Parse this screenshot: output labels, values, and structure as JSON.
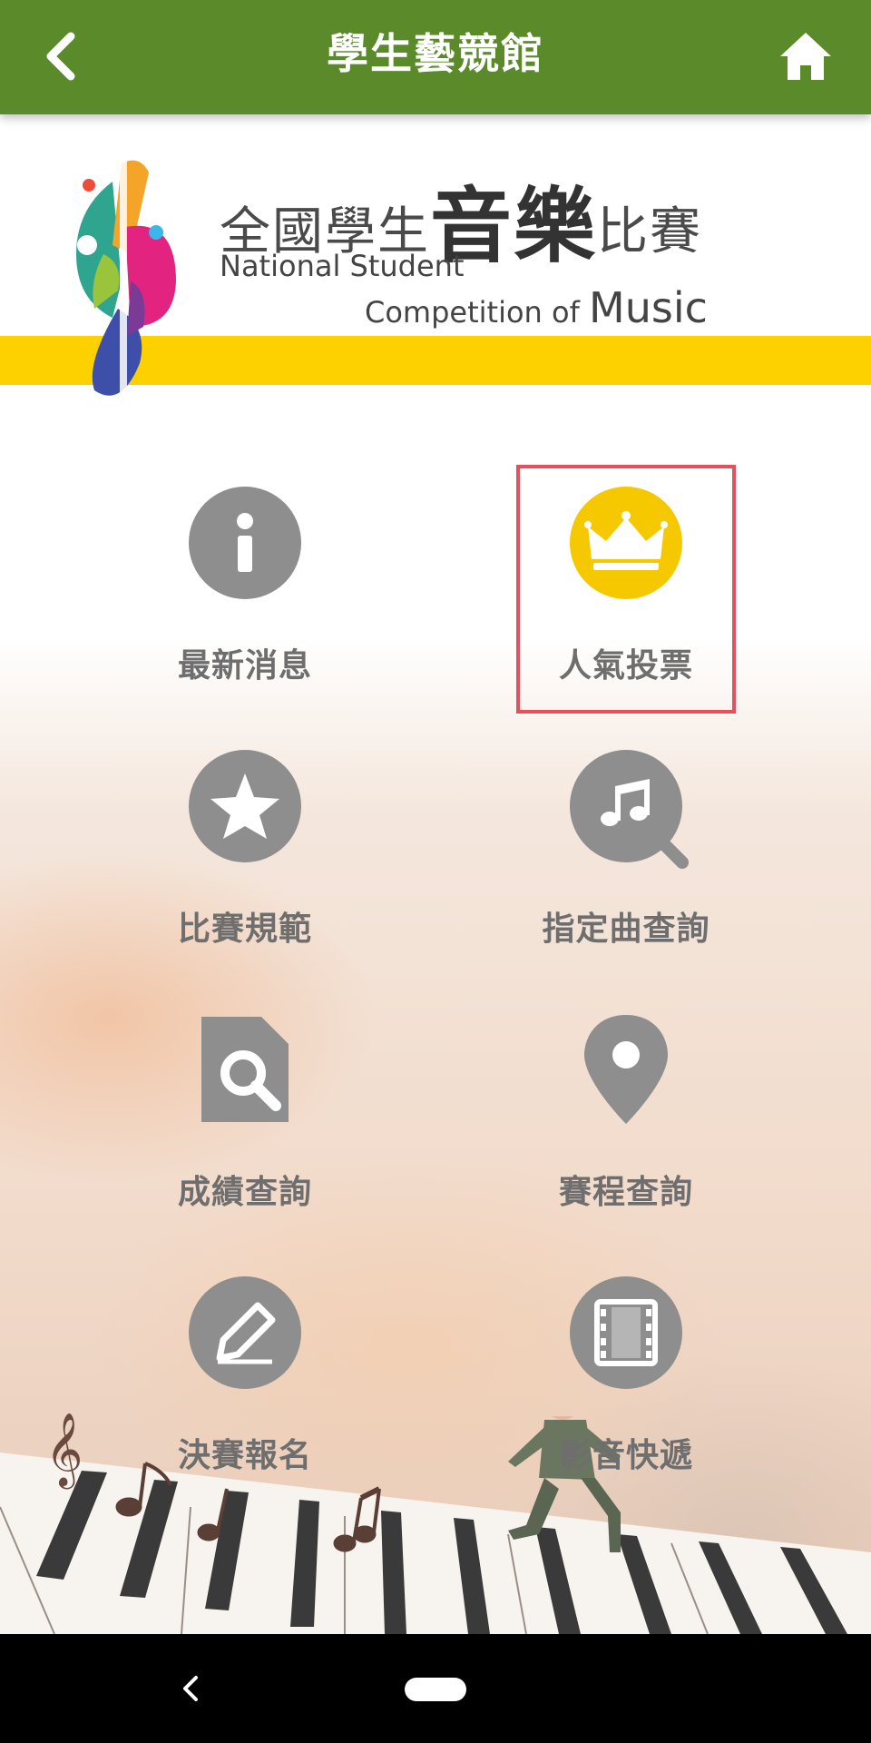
{
  "header": {
    "title": "學生藝競館",
    "back_icon": "chevron-left-icon",
    "home_icon": "home-icon"
  },
  "logo": {
    "cn_prefix": "全國學生",
    "cn_big": "音樂",
    "cn_suffix": "比賽",
    "en_line1": "National Student",
    "en_line2": "Competition of",
    "en_music": "Music"
  },
  "menu": [
    {
      "label": "最新消息",
      "icon": "info-icon"
    },
    {
      "label": "人氣投票",
      "icon": "crown-icon",
      "highlighted": true,
      "color": "#f6c800"
    },
    {
      "label": "比賽規範",
      "icon": "star-icon"
    },
    {
      "label": "指定曲查詢",
      "icon": "music-search-icon"
    },
    {
      "label": "成績查詢",
      "icon": "document-search-icon"
    },
    {
      "label": "賽程查詢",
      "icon": "location-pin-icon"
    },
    {
      "label": "決賽報名",
      "icon": "pencil-icon"
    },
    {
      "label": "影音快遞",
      "icon": "film-icon"
    }
  ],
  "colors": {
    "header_bg": "#5a8a2a",
    "stripe": "#fdd100",
    "icon_gray": "#8e8e8e",
    "highlight_border": "#e5505c"
  },
  "system_nav": {
    "back_icon": "nav-back-icon",
    "home_icon": "nav-home-pill-icon"
  }
}
